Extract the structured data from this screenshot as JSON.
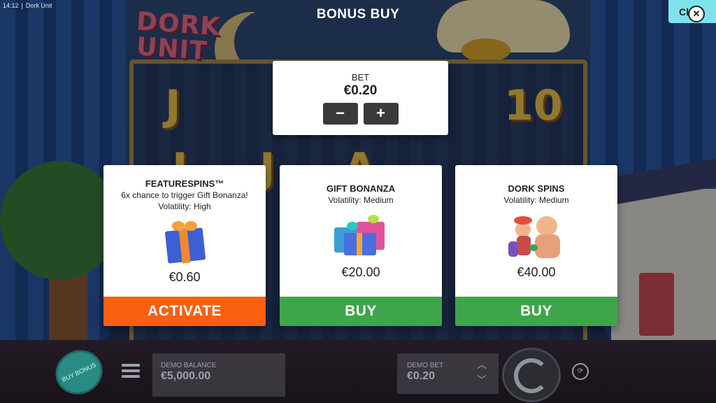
{
  "status_bar": {
    "time": "14:12",
    "separator": "|",
    "app": "Dork Unit"
  },
  "logo": {
    "line1": "DORK",
    "line2": "UNIT"
  },
  "modal": {
    "title": "BONUS BUY",
    "close_label": "Clo"
  },
  "bet": {
    "label": "BET",
    "value": "€0.20",
    "minus": "−",
    "plus": "+"
  },
  "offers": [
    {
      "title": "FEATURESPINS™",
      "subtitle": "6x chance to trigger Gift Bonanza!",
      "volatility": "Volatility: High",
      "price": "€0.60",
      "button": "ACTIVATE",
      "button_color": "#fa5f10",
      "icon": "single-gift-icon"
    },
    {
      "title": "GIFT BONANZA",
      "volatility": "Volatility: Medium",
      "price": "€20.00",
      "button": "BUY",
      "button_color": "#3ea54a",
      "icon": "gift-pile-icon"
    },
    {
      "title": "DORK SPINS",
      "volatility": "Volatility: Medium",
      "price": "€40.00",
      "button": "BUY",
      "button_color": "#3ea54a",
      "icon": "clown-family-icon"
    }
  ],
  "hud": {
    "buy_bonus": "BUY BONUS",
    "balance_label": "DEMO BALANCE",
    "balance_value": "€5,000.00",
    "bet_label": "DEMO BET",
    "bet_value": "€0.20"
  },
  "reel_symbols": [
    "J",
    "10",
    "J",
    "J",
    "A"
  ]
}
